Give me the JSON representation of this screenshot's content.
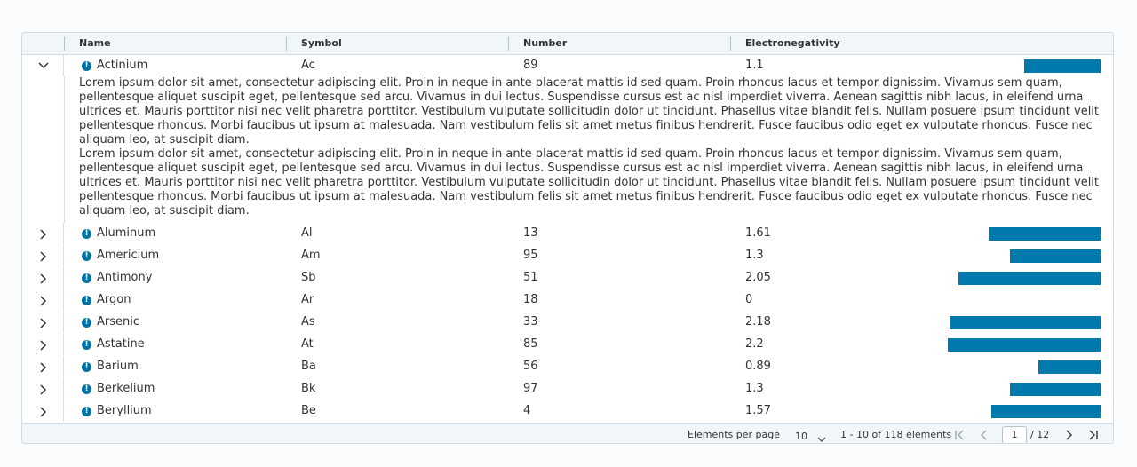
{
  "columns": {
    "name": "Name",
    "symbol": "Symbol",
    "number": "Number",
    "electronegativity": "Electronegativity"
  },
  "expanded_detail": [
    "Lorem ipsum dolor sit amet, consectetur adipiscing elit. Proin in neque in ante placerat mattis id sed quam. Proin rhoncus lacus et tempor dignissim. Vivamus sem quam, pellentesque aliquet suscipit eget, pellentesque sed arcu. Vivamus in dui lectus. Suspendisse cursus est ac nisl imperdiet viverra. Aenean sagittis nibh lacus, in eleifend urna ultrices et. Mauris porttitor nisi nec velit pharetra porttitor. Vestibulum vulputate sollicitudin dolor ut tincidunt. Phasellus vitae blandit felis. Nullam posuere ipsum tincidunt velit pellentesque rhoncus. Morbi faucibus ut ipsum at malesuada. Nam vestibulum felis sit amet metus finibus hendrerit. Fusce faucibus odio eget ex vulputate rhoncus. Fusce nec aliquam leo, at suscipit diam.",
    "Lorem ipsum dolor sit amet, consectetur adipiscing elit. Proin in neque in ante placerat mattis id sed quam. Proin rhoncus lacus et tempor dignissim. Vivamus sem quam, pellentesque aliquet suscipit eget, pellentesque sed arcu. Vivamus in dui lectus. Suspendisse cursus est ac nisl imperdiet viverra. Aenean sagittis nibh lacus, in eleifend urna ultrices et. Mauris porttitor nisi nec velit pharetra porttitor. Vestibulum vulputate sollicitudin dolor ut tincidunt. Phasellus vitae blandit felis. Nullam posuere ipsum tincidunt velit pellentesque rhoncus. Morbi faucibus ut ipsum at malesuada. Nam vestibulum felis sit amet metus finibus hendrerit. Fusce faucibus odio eget ex vulputate rhoncus. Fusce nec aliquam leo, at suscipit diam."
  ],
  "rows": [
    {
      "name": "Actinium",
      "symbol": "Ac",
      "number": "89",
      "electronegativity": "1.1",
      "expanded": true
    },
    {
      "name": "Aluminum",
      "symbol": "Al",
      "number": "13",
      "electronegativity": "1.61",
      "expanded": false
    },
    {
      "name": "Americium",
      "symbol": "Am",
      "number": "95",
      "electronegativity": "1.3",
      "expanded": false
    },
    {
      "name": "Antimony",
      "symbol": "Sb",
      "number": "51",
      "electronegativity": "2.05",
      "expanded": false
    },
    {
      "name": "Argon",
      "symbol": "Ar",
      "number": "18",
      "electronegativity": "0",
      "expanded": false
    },
    {
      "name": "Arsenic",
      "symbol": "As",
      "number": "33",
      "electronegativity": "2.18",
      "expanded": false
    },
    {
      "name": "Astatine",
      "symbol": "At",
      "number": "85",
      "electronegativity": "2.2",
      "expanded": false
    },
    {
      "name": "Barium",
      "symbol": "Ba",
      "number": "56",
      "electronegativity": "0.89",
      "expanded": false
    },
    {
      "name": "Berkelium",
      "symbol": "Bk",
      "number": "97",
      "electronegativity": "1.3",
      "expanded": false
    },
    {
      "name": "Beryllium",
      "symbol": "Be",
      "number": "4",
      "electronegativity": "1.57",
      "expanded": false
    }
  ],
  "bar_scale_max": 2.75,
  "footer": {
    "per_page_label": "Elements per page",
    "per_page_value": "10",
    "range_label": "1 - 10 of 118 elements",
    "current_page": "1",
    "total_pages": "/ 12"
  },
  "colors": {
    "accent": "#0079ad",
    "alert": "#0072a3"
  }
}
